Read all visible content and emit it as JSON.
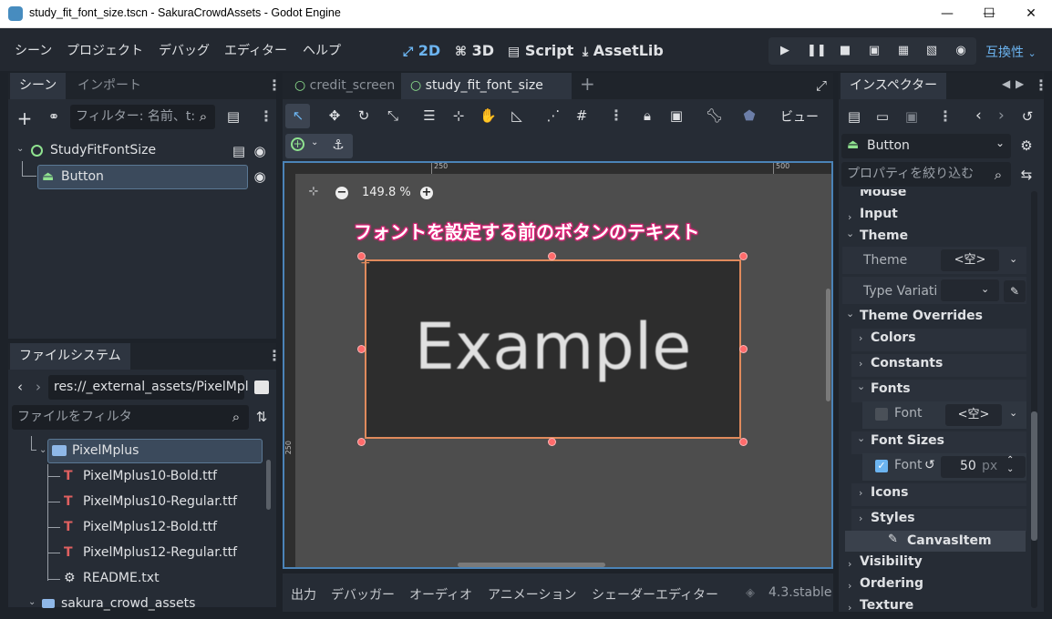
{
  "window": {
    "title": "study_fit_font_size.tscn - SakuraCrowdAssets - Godot Engine",
    "minimize": "—",
    "maximize": "☐",
    "close": "✕"
  },
  "menu": {
    "items": [
      "シーン",
      "プロジェクト",
      "デバッグ",
      "エディター",
      "ヘルプ"
    ]
  },
  "workspace": {
    "tabs": [
      "2D",
      "3D",
      "Script",
      "AssetLib"
    ],
    "active": "2D",
    "compat": "互換性"
  },
  "scene_dock": {
    "tabs": [
      "シーン",
      "インポート"
    ],
    "filter_placeholder": "フィルター: 名前、t:",
    "nodes": [
      {
        "name": "StudyFitFontSize"
      },
      {
        "name": "Button"
      }
    ]
  },
  "filesystem_dock": {
    "tab": "ファイルシステム",
    "path": "res://_external_assets/PixelMpl",
    "filter_placeholder": "ファイルをフィルタ",
    "folder": "PixelMplus",
    "files": [
      "PixelMplus10-Bold.ttf",
      "PixelMplus10-Regular.ttf",
      "PixelMplus12-Bold.ttf",
      "PixelMplus12-Regular.ttf",
      "README.txt"
    ],
    "next_folder": "sakura_crowd_assets"
  },
  "editor": {
    "tabs": [
      "credit_screen",
      "study_fit_font_size"
    ],
    "view_label": "ビュー",
    "zoom": "149.8 %",
    "ruler": [
      "250",
      "500"
    ],
    "vruler": "250",
    "annotation": "フォントを設定する前のボタンのテキスト",
    "button_text": "Example"
  },
  "bottom_panel": {
    "tabs": [
      "出力",
      "デバッガー",
      "オーディオ",
      "アニメーション",
      "シェーダーエディター"
    ],
    "version": "4.3.stable"
  },
  "inspector": {
    "tab": "インスペクター",
    "node": "Button",
    "filter_placeholder": "プロパティを絞り込む",
    "sections": {
      "mouse": "Mouse",
      "input": "Input",
      "theme": "Theme",
      "theme_prop": "Theme",
      "theme_value": "<空>",
      "type_variation": "Type Variati",
      "overrides": "Theme Overrides",
      "colors": "Colors",
      "constants": "Constants",
      "fonts": "Fonts",
      "font_prop": "Font",
      "font_value": "<空>",
      "font_sizes": "Font Sizes",
      "font_size_prop": "Font",
      "font_size_value": "50",
      "font_size_unit": "px",
      "icons": "Icons",
      "styles": "Styles",
      "canvas_item": "CanvasItem",
      "visibility": "Visibility",
      "ordering": "Ordering",
      "texture": "Texture"
    }
  }
}
